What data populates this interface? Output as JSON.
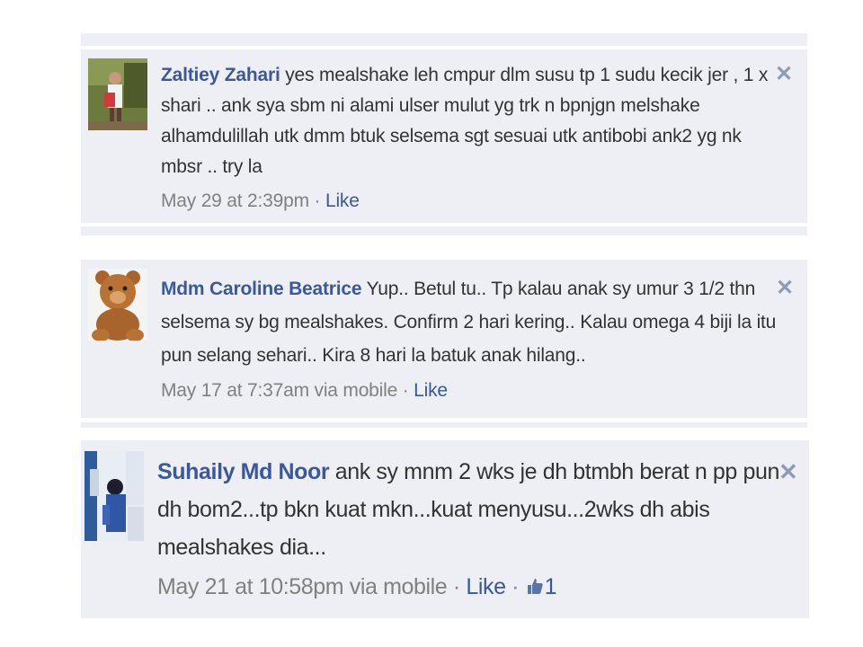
{
  "comments": [
    {
      "author": "Zaltiey Zahari",
      "text": "yes mealshake leh cmpur dlm susu tp 1 sudu kecik jer , 1 x shari .. ank sya sbm ni alami ulser mulut yg trk n bpnjgn melshake alhamdulillah utk dmm btuk selsema sgt sesuai utk antibobi ank2 yg nk mbsr .. try la",
      "time": "May 29 at 2:39pm",
      "sep": " · ",
      "like": "Like"
    },
    {
      "author": "Mdm Caroline Beatrice",
      "text": "Yup.. Betul tu.. Tp kalau anak sy umur 3 1/2 thn selsema sy bg mealshakes. Confirm 2 hari kering.. Kalau omega 4 biji la itu pun selang sehari.. Kira 8 hari la batuk anak hilang..",
      "time": "May 17 at 7:37am via mobile",
      "sep": " · ",
      "like": "Like"
    },
    {
      "author": "Suhaily Md Noor",
      "text": "ank sy mnm 2 wks je dh btmbh berat n pp pun dh bom2...tp bkn kuat mkn...kuat menyusu...2wks dh abis mealshakes dia...",
      "time": "May 21 at 10:58pm via mobile",
      "sep": " · ",
      "like": "Like",
      "sep2": " · ",
      "like_count": "1"
    }
  ],
  "close_glyph": "✕",
  "colors": {
    "background": "#edeff4",
    "link": "#3b5998",
    "text": "#333333",
    "meta": "#808080",
    "close": "#8e9bb7"
  }
}
